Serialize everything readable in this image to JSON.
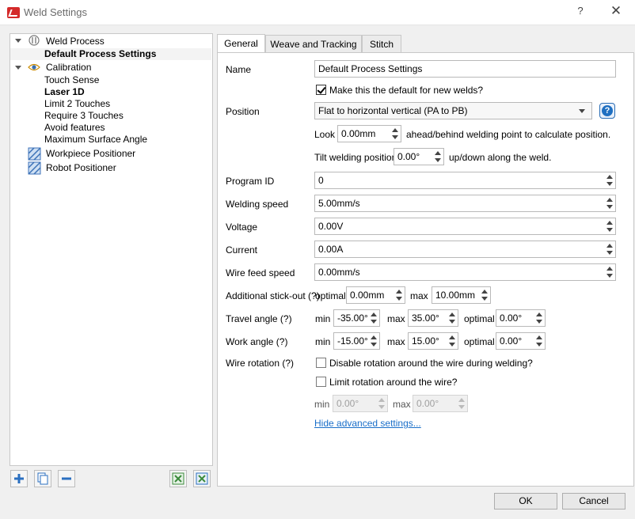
{
  "window": {
    "title": "Weld Settings",
    "help_glyph": "?",
    "close_glyph": "✕"
  },
  "tree": {
    "weld_process": "Weld Process",
    "default_process_settings": "Default Process Settings",
    "calibration": "Calibration",
    "touch_sense": "Touch Sense",
    "laser_1d": "Laser 1D",
    "limit_2_touches": "Limit 2 Touches",
    "require_3_touches": "Require 3 Touches",
    "avoid_features": "Avoid features",
    "maximum_surface_angle": "Maximum Surface Angle",
    "workpiece_positioner": "Workpiece Positioner",
    "robot_positioner": "Robot Positioner"
  },
  "tabs": {
    "general": "General",
    "weave": "Weave and Tracking",
    "stitch": "Stitch"
  },
  "form": {
    "name_label": "Name",
    "name_value": "Default Process Settings",
    "make_default_label": "Make this the default for new welds?",
    "position_label": "Position",
    "position_value": "Flat to horizontal vertical (PA to PB)",
    "look_label": "Look",
    "look_value": "0.00mm",
    "look_suffix": "ahead/behind welding point to calculate position.",
    "tilt_label": "Tilt welding position",
    "tilt_value": "0.00°",
    "tilt_suffix": "up/down along the weld.",
    "program_id_label": "Program ID",
    "program_id_value": "0",
    "welding_speed_label": "Welding speed",
    "welding_speed_value": "5.00mm/s",
    "voltage_label": "Voltage",
    "voltage_value": "0.00V",
    "current_label": "Current",
    "current_value": "0.00A",
    "wire_feed_label": "Wire feed speed",
    "wire_feed_value": "0.00mm/s",
    "stickout_label": "Additional stick-out (?)",
    "optimal_label": "optimal",
    "stickout_optimal": "0.00mm",
    "max_label": "max",
    "stickout_max": "10.00mm",
    "travel_label": "Travel angle (?)",
    "min_label": "min",
    "travel_min": "-35.00°",
    "travel_max": "35.00°",
    "travel_optimal": "0.00°",
    "work_label": "Work angle (?)",
    "work_min": "-15.00°",
    "work_max": "15.00°",
    "work_optimal": "0.00°",
    "wire_rotation_label": "Wire rotation (?)",
    "disable_rotation_label": "Disable rotation around the wire during welding?",
    "limit_rotation_label": "Limit rotation around the wire?",
    "rot_min": "0.00°",
    "rot_max": "0.00°",
    "hide_advanced": "Hide advanced settings..."
  },
  "footer": {
    "ok": "OK",
    "cancel": "Cancel"
  }
}
